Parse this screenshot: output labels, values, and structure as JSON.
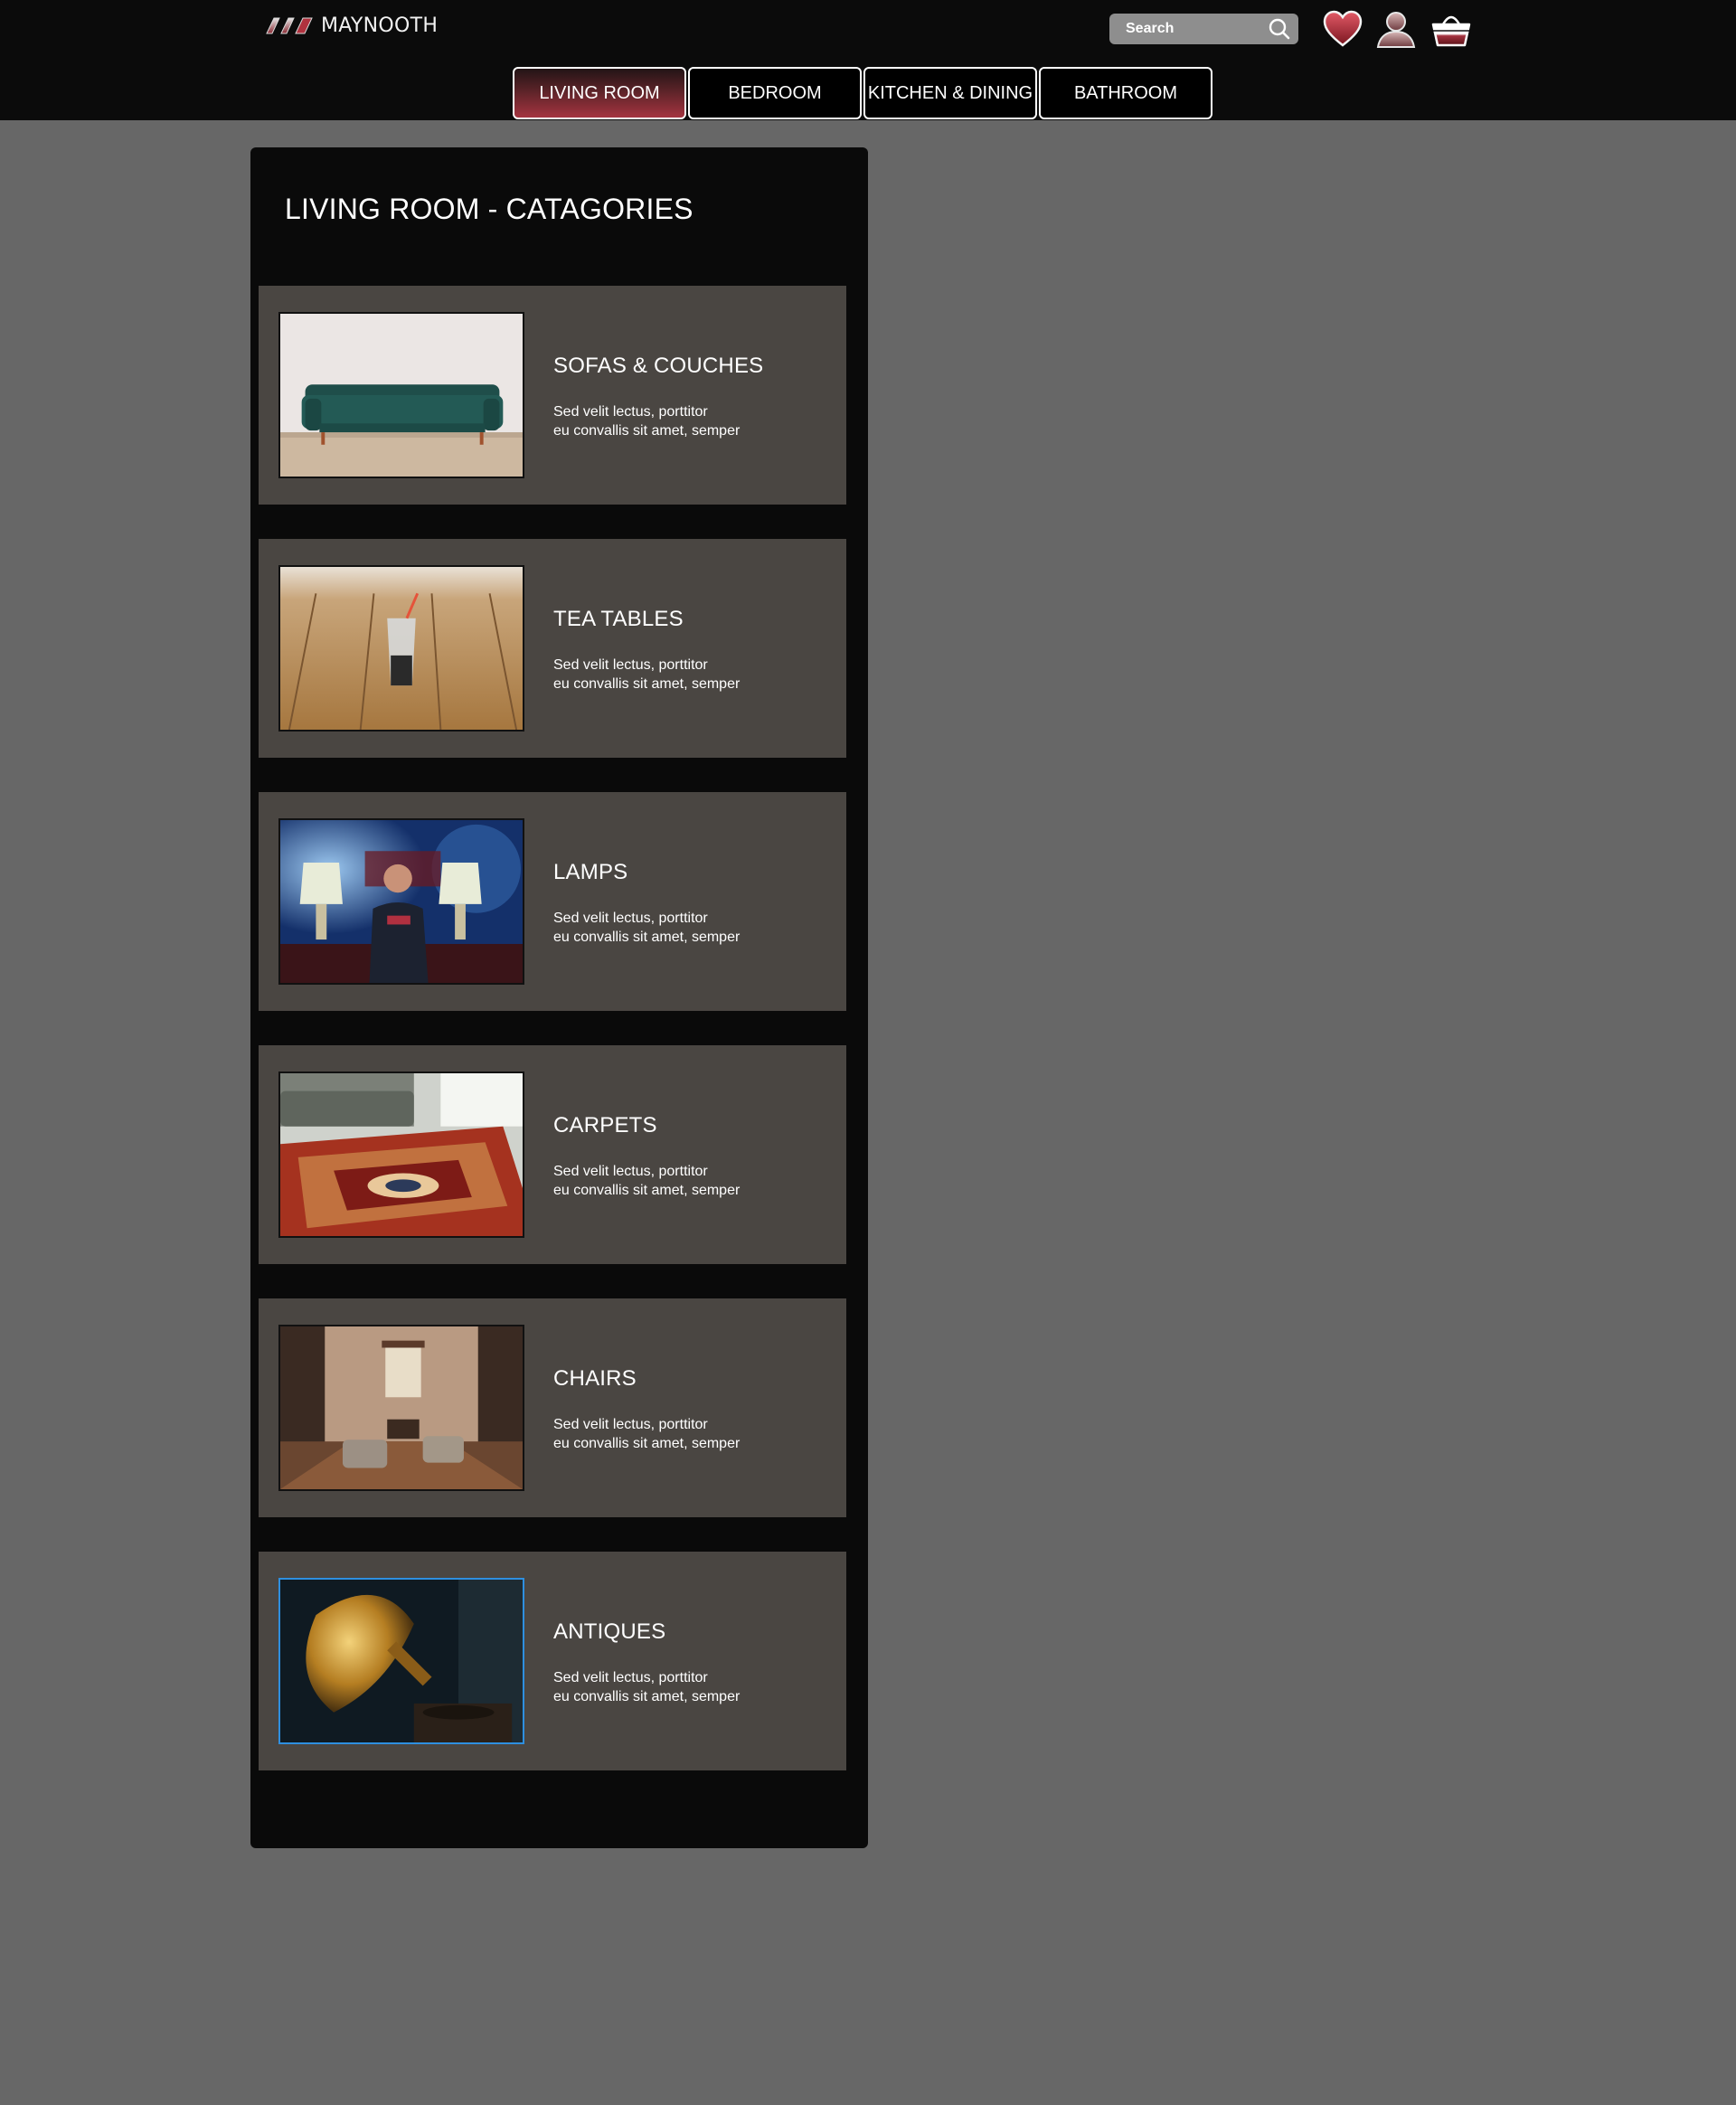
{
  "header": {
    "brand": "MAYNOOTH",
    "search": {
      "placeholder": "Search"
    },
    "icons": [
      "heart-icon",
      "user-icon",
      "basket-icon",
      "search-icon"
    ],
    "colors": {
      "bar": "#0b0b0b",
      "accent": "#a53440",
      "page": "#676767"
    }
  },
  "nav": {
    "tabs": [
      {
        "label": "LIVING ROOM",
        "active": true
      },
      {
        "label": "BEDROOM",
        "active": false
      },
      {
        "label": "KITCHEN & DINING",
        "active": false
      },
      {
        "label": "BATHROOM",
        "active": false
      }
    ]
  },
  "main": {
    "title": "LIVING ROOM - CATAGORIES",
    "categories": [
      {
        "title": "SOFAS & COUCHES",
        "line1": "Sed velit lectus, porttitor",
        "line2": "eu convallis sit amet, semper",
        "image": "green-sofa-photo"
      },
      {
        "title": "TEA TABLES",
        "line1": "Sed velit lectus, porttitor",
        "line2": "eu convallis sit amet, semper",
        "image": "glass-on-wooden-table-photo"
      },
      {
        "title": "LAMPS",
        "line1": "Sed velit lectus, porttitor",
        "line2": "eu convallis sit amet, semper",
        "image": "man-between-table-lamps-photo"
      },
      {
        "title": "CARPETS",
        "line1": "Sed velit lectus, porttitor",
        "line2": "eu convallis sit amet, semper",
        "image": "patterned-rug-photo"
      },
      {
        "title": "CHAIRS",
        "line1": "Sed velit lectus, porttitor",
        "line2": "eu convallis sit amet, semper",
        "image": "living-room-armchairs-photo"
      },
      {
        "title": "ANTIQUES",
        "line1": "Sed velit lectus, porttitor",
        "line2": "eu convallis sit amet, semper",
        "image": "gramophone-horn-photo"
      }
    ]
  }
}
